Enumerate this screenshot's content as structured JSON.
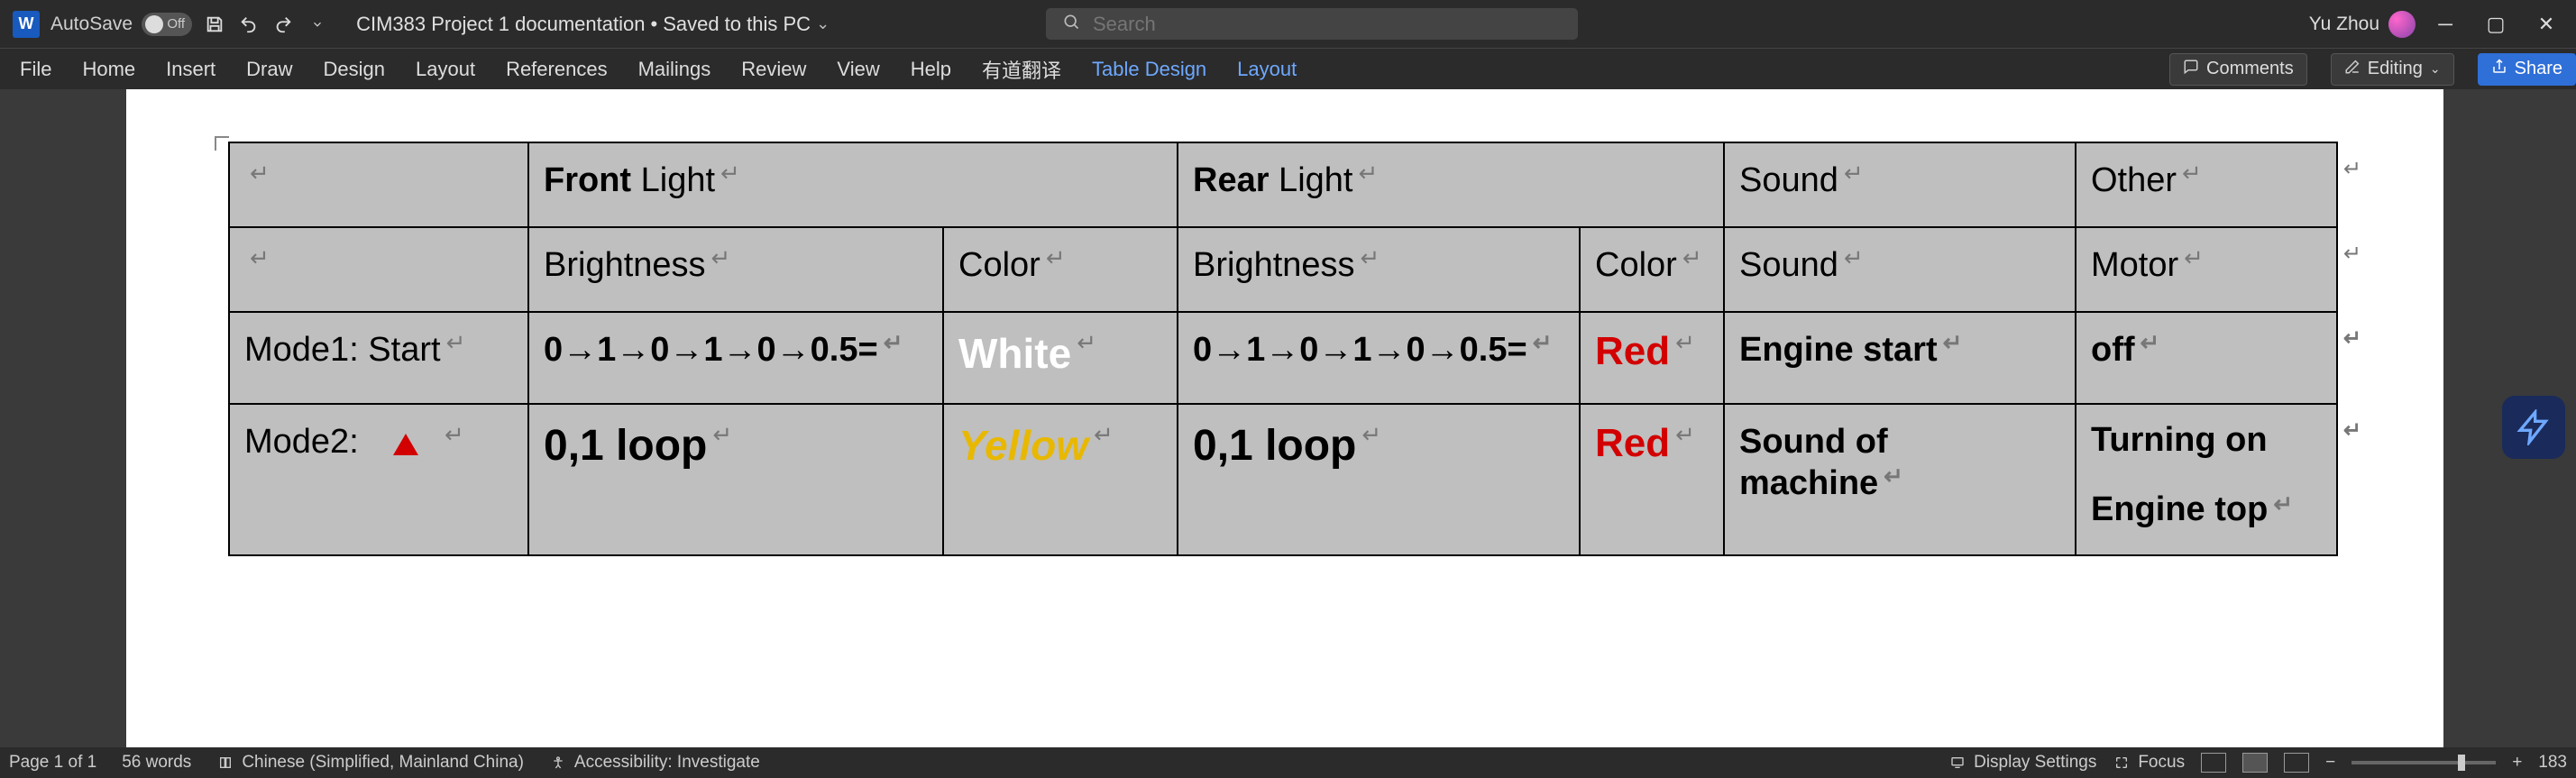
{
  "titlebar": {
    "autosave_label": "AutoSave",
    "autosave_state": "Off",
    "doc_name": "CIM383 Project 1 documentation",
    "doc_status": "Saved to this PC",
    "search_placeholder": "Search",
    "user_name": "Yu Zhou"
  },
  "ribbon": {
    "tabs": [
      "File",
      "Home",
      "Insert",
      "Draw",
      "Design",
      "Layout",
      "References",
      "Mailings",
      "Review",
      "View",
      "Help",
      "有道翻译"
    ],
    "context_tabs": [
      "Table Design",
      "Layout"
    ],
    "comments": "Comments",
    "editing": "Editing",
    "share": "Share"
  },
  "table": {
    "header_row1": {
      "c0": "",
      "c1_strong": "Front",
      "c1_light": " Light",
      "c2_strong": "Rear",
      "c2_light": " Light",
      "c3": "Sound",
      "c4": "Other"
    },
    "header_row2": {
      "c0": "",
      "c1": "Brightness",
      "c2": "Color",
      "c3": "Brightness",
      "c4": "Color",
      "c5": "Sound",
      "c6": "Motor"
    },
    "rows": [
      {
        "label": "Mode1: Start",
        "front_brightness": "0→1→0→1→0→0.5=",
        "front_color": "White",
        "rear_brightness": "0→1→0→1→0→0.5=",
        "rear_color": "Red",
        "sound": "Engine start",
        "other": "off"
      },
      {
        "label": "Mode2:",
        "front_brightness": "0,1 loop",
        "front_color": "Yellow",
        "rear_brightness": "0,1 loop",
        "rear_color": "Red",
        "sound": "Sound of machine",
        "other_l1": "Turning on",
        "other_l2": "Engine top"
      }
    ]
  },
  "statusbar": {
    "page": "Page 1 of 1",
    "words": "56 words",
    "language": "Chinese (Simplified, Mainland China)",
    "accessibility": "Accessibility: Investigate",
    "display_settings": "Display Settings",
    "focus": "Focus",
    "zoom": "183"
  },
  "colors": {
    "accent_blue": "#2f6fd8",
    "red": "#d20000",
    "yellow": "#e8b800",
    "table_bg": "#bfbfbf"
  }
}
